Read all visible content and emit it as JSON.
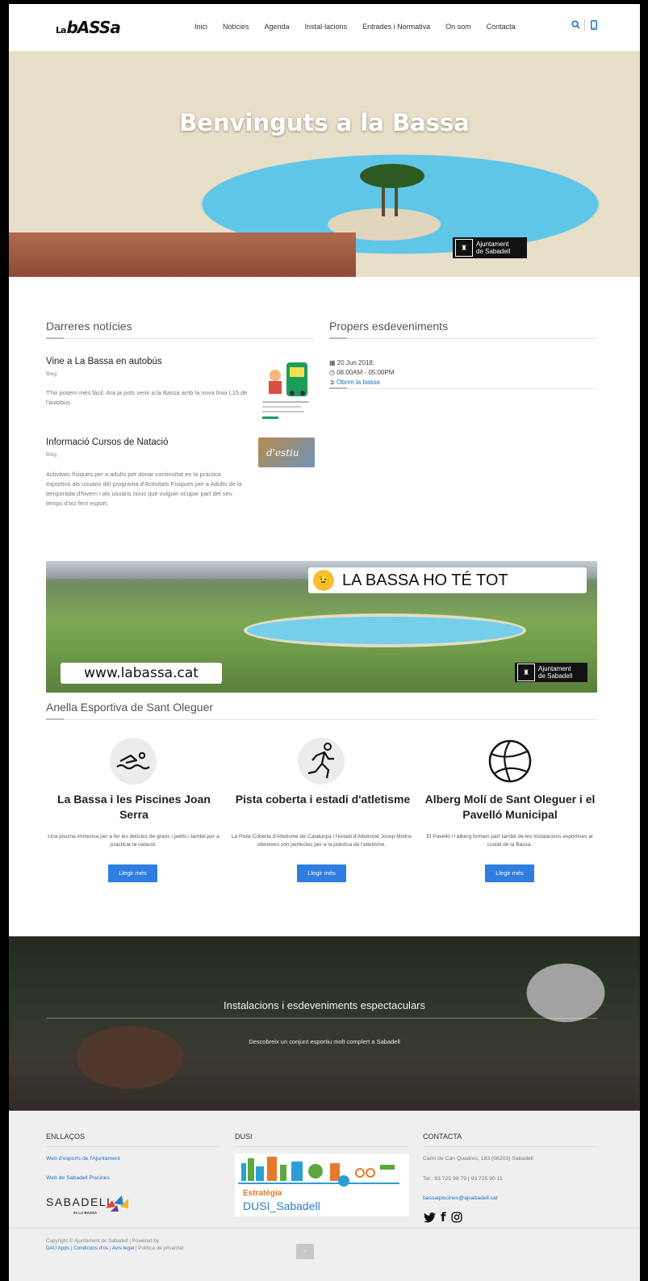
{
  "header": {
    "logo_prefix": "La",
    "logo_main": "bASSa",
    "nav": [
      "Inici",
      "Notícies",
      "Agenda",
      "Instal·lacions",
      "Entrades i Normativa",
      "On som",
      "Contacta"
    ],
    "search_icon": "search-icon",
    "mobile_icon": "mobile-icon"
  },
  "hero": {
    "title": "Benvinguts a la Bassa",
    "badge": [
      "Ajuntament",
      "de Sabadell"
    ]
  },
  "news": {
    "section_title": "Darreres notícies",
    "items": [
      {
        "title": "Vine a La Bassa en autobús",
        "category": "Blog",
        "text": "T'ho posem més fàcil. Ara ja pots venir a la Bassa amb la nova línia L15 de l'autobús."
      },
      {
        "title": "Informació Cursos de Natació",
        "category": "Blog",
        "text": "Activitats físiques per a adults per donar continuïtat en la pràctica esportiva als usuaris del programa d'Activitats Físiques per a Adults de la temporada d'hivern i als usuaris nous que vulguin ocupar part del seu temps d'oci fent esport.",
        "thumb_text": "d'estiu"
      }
    ]
  },
  "events": {
    "section_title": "Propers esdeveniments",
    "items": [
      {
        "date": "20 Jun 2018;",
        "time": "08:00AM - 05:00PM",
        "link": "Obrim la bassa"
      }
    ]
  },
  "banner": {
    "slogan": "LA BASSA HO TÉ TOT",
    "url": "www.labassa.cat",
    "badge": [
      "Ajuntament",
      "de Sabadell"
    ]
  },
  "anella": {
    "section_title": "Anella Esportiva de Sant Oleguer",
    "items": [
      {
        "icon": "swimmer-icon",
        "title": "La Bassa i les Piscines Joan Serra",
        "desc": "Una piscina immensa per a fer les delícies de grans i petits i també per a practicar la natació.",
        "button": "Llegir més"
      },
      {
        "icon": "runner-icon",
        "title": "Pista coberta i estadi d'atletisme",
        "desc": "La Pista Coberta d'Atletisme de Catalunya i l'estadi d'Atletisme Josep Molins ofereixen són perfectes per a la pràctica de l'atletisme.",
        "button": "Llegir més"
      },
      {
        "icon": "volleyball-icon",
        "title": "Alberg Molí de Sant Oleguer i el Pavelló Municipal",
        "desc": "El Pavelló i l'alberg formen part també de les instalacions esportives al costat de la Bassa.",
        "button": "Llegir més"
      }
    ]
  },
  "band": {
    "title": "Instalacions i esdeveniments espectaculars",
    "subtitle": "Descobreix un conjunt esportiu molt complert a Sabadell"
  },
  "footer": {
    "links_title": "ENLLAÇOS",
    "links": [
      "Web d'esports de l'Ajuntament",
      "Web de Sabadell Piscines"
    ],
    "sabadell_logo": "SABADELL",
    "sabadell_logo_sub": "és LA BASSA",
    "dusi_title": "DUSI",
    "dusi_line1": "Estratègia",
    "dusi_line2": "DUSI_Sabadell",
    "contact_title": "CONTACTA",
    "address": "Camí de Can Quadres, 183 (08203) Sabadell",
    "phone": "Tel.: 93 725 99 79 | 93 725 90 11",
    "email": "bassaipiscines@ajsabadell.cat",
    "social": [
      "twitter-icon",
      "facebook-icon",
      "instagram-icon"
    ],
    "copyright": "Copyright © Ajuntament de Sabadell | Powered by",
    "legal": [
      "DAU Apps",
      "Condicons d'ús",
      "Avís legal",
      "Política de privacitat"
    ],
    "top_button": "↑"
  },
  "colors": {
    "accent": "#2d7ee0",
    "link": "#1e6fc7"
  }
}
